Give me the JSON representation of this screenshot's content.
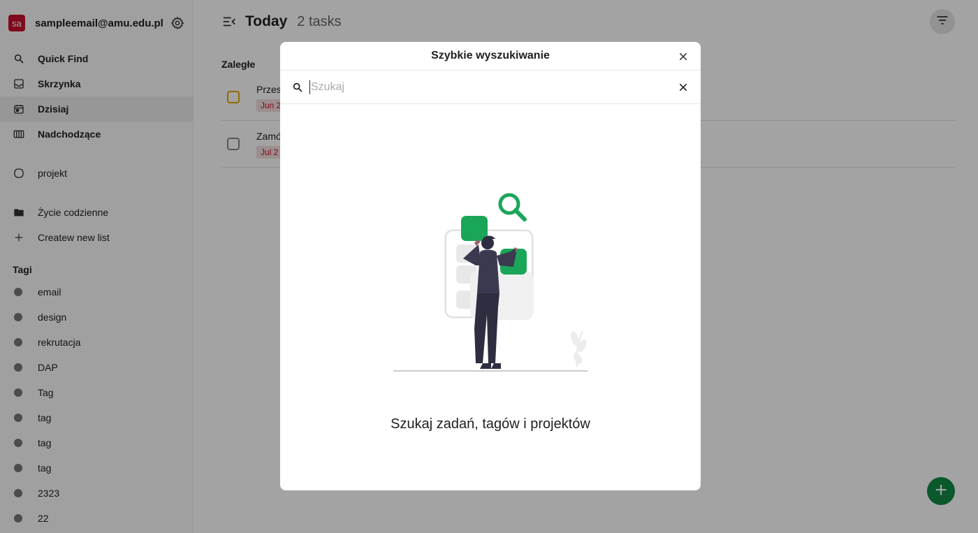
{
  "account": {
    "avatar_text": "sa",
    "email": "sampleemail@amu.edu.pl"
  },
  "nav": [
    {
      "label": "Quick Find",
      "icon": "search-icon"
    },
    {
      "label": "Skrzynka",
      "icon": "inbox-icon"
    },
    {
      "label": "Dzisiaj",
      "icon": "calendar-icon",
      "active": true
    },
    {
      "label": "Nadchodzące",
      "icon": "upcoming-icon"
    }
  ],
  "projects": [
    {
      "label": "projekt",
      "icon": "circle-icon"
    }
  ],
  "folders": [
    {
      "label": "Życie codzienne",
      "icon": "folder-icon"
    }
  ],
  "create_list_label": "Createw new list",
  "tags_title": "Tagi",
  "tags": [
    "email",
    "design",
    "rekrutacja",
    "DAP",
    "Tag",
    "tag",
    "tag",
    "tag",
    "2323",
    "22"
  ],
  "main": {
    "title": "Today",
    "count": "2 tasks",
    "group_title": "Zaległe",
    "tasks": [
      {
        "name": "Przes",
        "due": "Jun 2"
      },
      {
        "name": "Zamó",
        "due": "Jul 2"
      }
    ]
  },
  "modal": {
    "title": "Szybkie wyszukiwanie",
    "search_placeholder": "Szukaj",
    "search_value": "",
    "hint": "Szukaj zadań, tagów i projektów"
  },
  "colors": {
    "avatar": "#c8102e",
    "accent": "#118a46",
    "overdue": "#e0a800",
    "due_text": "#c8102e"
  }
}
